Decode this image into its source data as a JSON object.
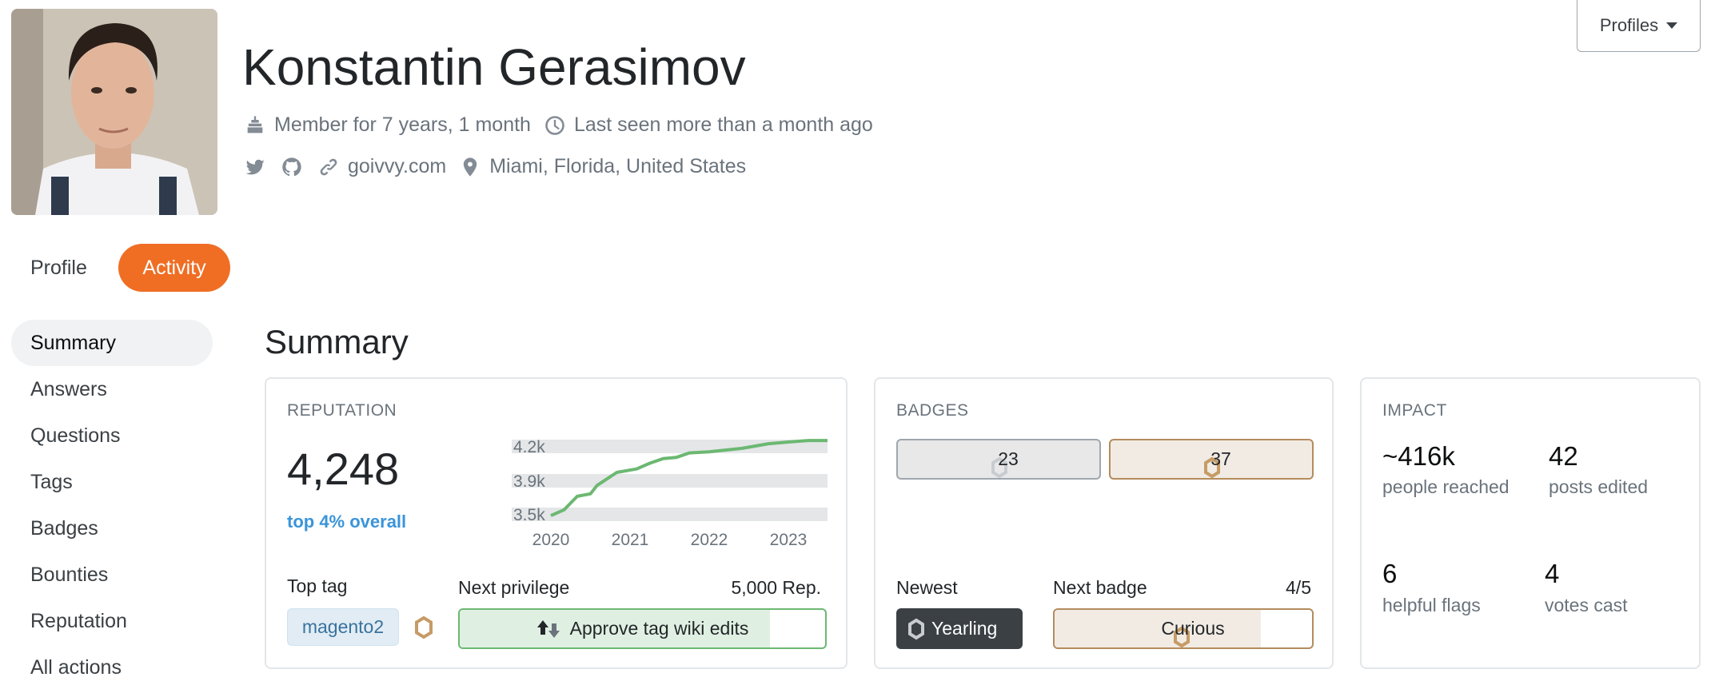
{
  "header": {
    "name": "Konstantin Gerasimov",
    "member_for": "Member for 7 years, 1 month",
    "last_seen": "Last seen more than a month ago",
    "website": "goivvy.com",
    "location": "Miami, Florida, United States",
    "profiles_label": "Profiles"
  },
  "tabs": [
    {
      "label": "Profile"
    },
    {
      "label": "Activity",
      "selected": true
    }
  ],
  "sidebar": {
    "items": [
      {
        "label": "Summary",
        "selected": true
      },
      {
        "label": "Answers"
      },
      {
        "label": "Questions"
      },
      {
        "label": "Tags"
      },
      {
        "label": "Badges"
      },
      {
        "label": "Bounties"
      },
      {
        "label": "Reputation"
      },
      {
        "label": "All actions"
      }
    ]
  },
  "summary": {
    "title": "Summary",
    "reputation": {
      "caption": "REPUTATION",
      "value": "4,248",
      "rank": "top 4% overall",
      "top_tag_label": "Top tag",
      "top_tag": "magento2",
      "next_privilege_label": "Next privilege",
      "next_privilege_rep": "5,000 Rep.",
      "next_privilege": "Approve tag wiki edits",
      "privilege_progress": 0.85
    },
    "badges": {
      "caption": "BADGES",
      "silver": "23",
      "bronze": "37",
      "newest_label": "Newest",
      "newest": "Yearling",
      "next_badge_label": "Next badge",
      "next_badge_progress_text": "4/5",
      "next_badge": "Curious",
      "next_badge_progress": 0.8
    },
    "impact": {
      "caption": "IMPACT",
      "stats": [
        {
          "value": "~416k",
          "label": "people reached"
        },
        {
          "value": "42",
          "label": "posts edited"
        },
        {
          "value": "6",
          "label": "helpful flags"
        },
        {
          "value": "4",
          "label": "votes cast"
        }
      ]
    }
  },
  "colors": {
    "accent": "#ef6e24",
    "line": "#6cb872",
    "link": "#3b94d9",
    "bronze": "#c69b67",
    "silver": "#c8ccd0"
  },
  "chart_data": {
    "type": "line",
    "y_ticks": [
      "3.5k",
      "3.9k",
      "4.2k"
    ],
    "y_tick_values": [
      3500,
      3900,
      4200
    ],
    "x_ticks": [
      "2020",
      "2021",
      "2022",
      "2023"
    ],
    "points": [
      [
        "2020-01",
        3480
      ],
      [
        "2020-03",
        3550
      ],
      [
        "2020-05",
        3710
      ],
      [
        "2020-07",
        3740
      ],
      [
        "2020-08",
        3840
      ],
      [
        "2020-11",
        3970
      ],
      [
        "2021-02",
        4000
      ],
      [
        "2021-04",
        4050
      ],
      [
        "2021-06",
        4090
      ],
      [
        "2021-08",
        4100
      ],
      [
        "2021-10",
        4140
      ],
      [
        "2022-01",
        4150
      ],
      [
        "2022-06",
        4180
      ],
      [
        "2022-10",
        4220
      ],
      [
        "2023-01",
        4235
      ],
      [
        "2023-04",
        4248
      ],
      [
        "2023-07",
        4248
      ]
    ]
  }
}
